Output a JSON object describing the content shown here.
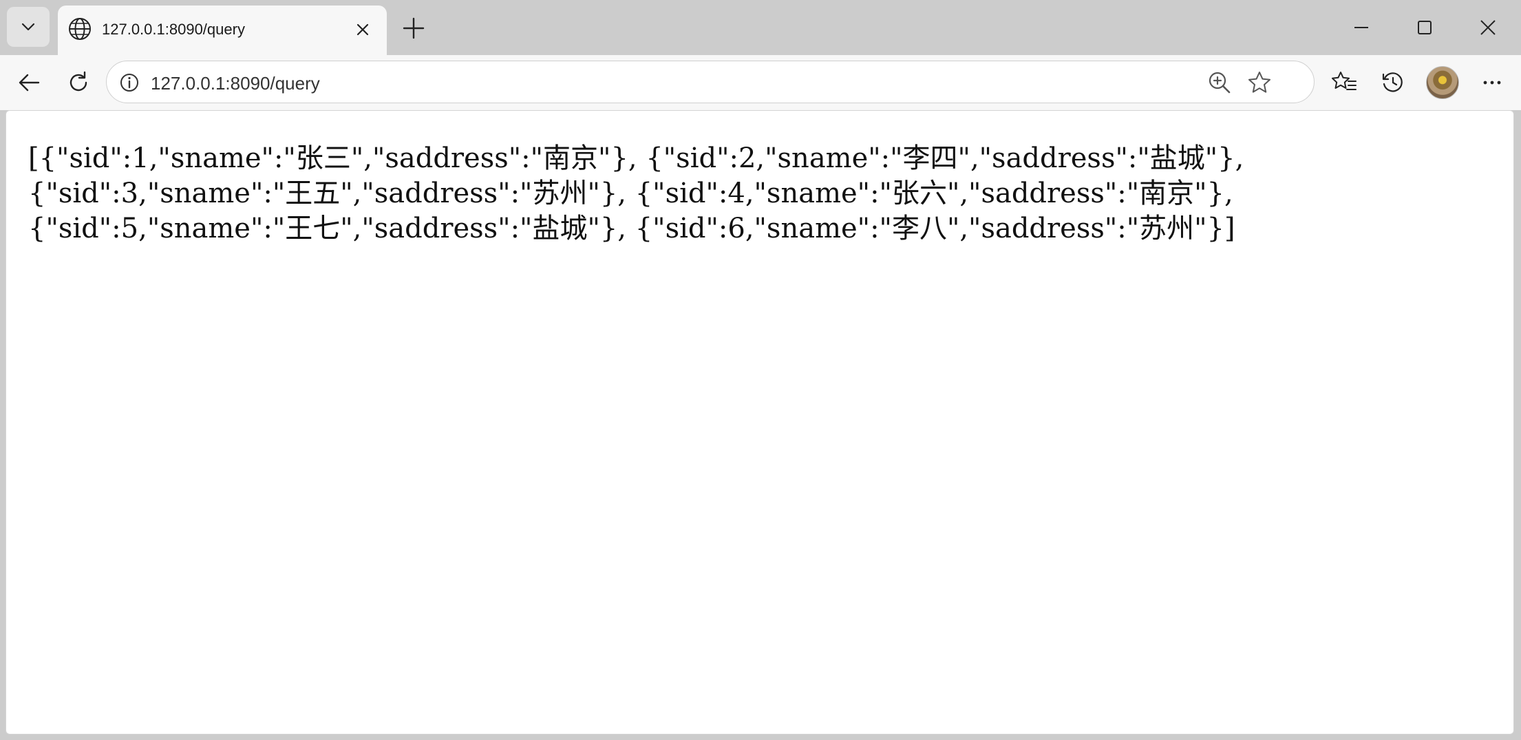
{
  "tab": {
    "title": "127.0.0.1:8090/query",
    "icon": "globe-icon"
  },
  "address_bar": {
    "url": "127.0.0.1:8090/query"
  },
  "page": {
    "body_text": "[{\"sid\":1,\"sname\":\"张三\",\"saddress\":\"南京\"}, {\"sid\":2,\"sname\":\"李四\",\"saddress\":\"盐城\"}, {\"sid\":3,\"sname\":\"王五\",\"saddress\":\"苏州\"}, {\"sid\":4,\"sname\":\"张六\",\"saddress\":\"南京\"}, {\"sid\":5,\"sname\":\"王七\",\"saddress\":\"盐城\"}, {\"sid\":6,\"sname\":\"李八\",\"saddress\":\"苏州\"}]"
  },
  "colors": {
    "titlebar": "#cccccc",
    "toolbar": "#f7f7f7",
    "content": "#ffffff"
  }
}
